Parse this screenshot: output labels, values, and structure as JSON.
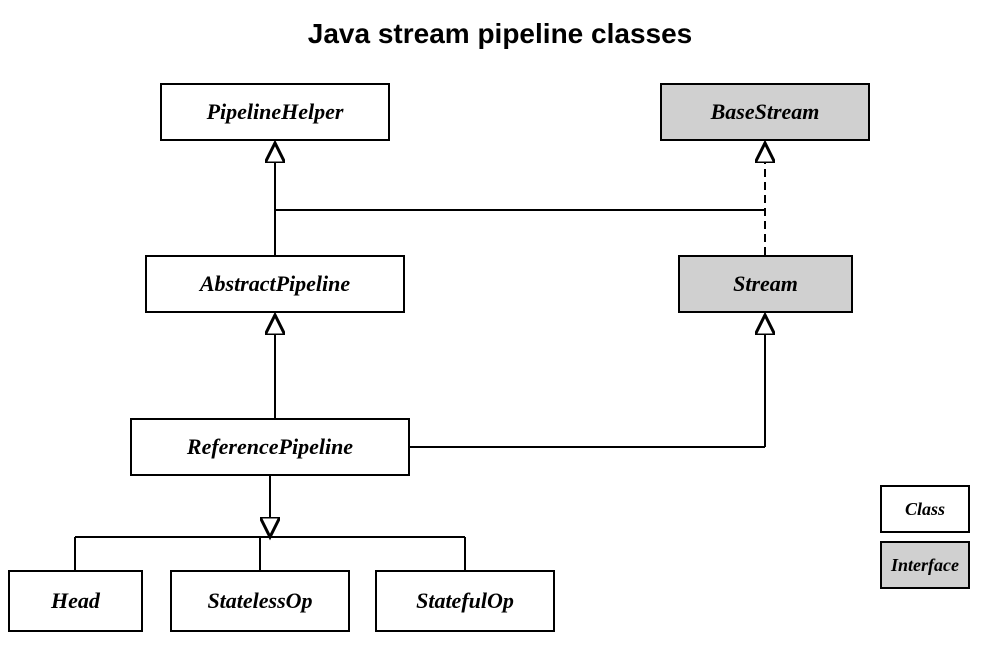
{
  "title": "Java stream pipeline classes",
  "boxes": {
    "pipelineHelper": {
      "label": "PipelineHelper",
      "type": "class"
    },
    "basestream": {
      "label": "BaseStream",
      "type": "interface"
    },
    "abstractpipeline": {
      "label": "AbstractPipeline",
      "type": "class"
    },
    "stream": {
      "label": "Stream",
      "type": "interface"
    },
    "referencepipeline": {
      "label": "ReferencePipeline",
      "type": "class"
    },
    "head": {
      "label": "Head",
      "type": "class"
    },
    "statelessop": {
      "label": "StatelessOp",
      "type": "class"
    },
    "statefulop": {
      "label": "StatefulOp",
      "type": "class"
    }
  },
  "legend": {
    "class_label": "Class",
    "interface_label": "Interface"
  }
}
